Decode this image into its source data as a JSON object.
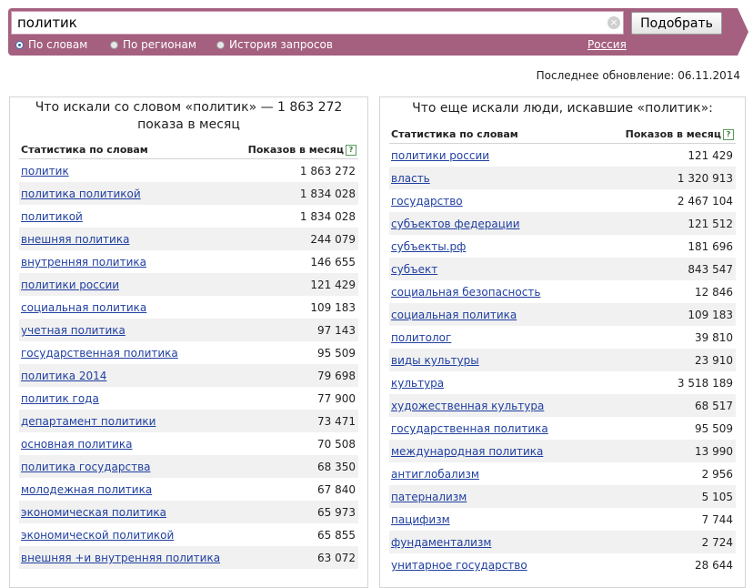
{
  "search": {
    "value": "политик",
    "submit_label": "Подобрать"
  },
  "tabs": [
    {
      "label": "По словам",
      "checked": true
    },
    {
      "label": "По регионам",
      "checked": false
    },
    {
      "label": "История запросов",
      "checked": false
    }
  ],
  "region": "Россия",
  "last_update": "Последнее обновление: 06.11.2014",
  "left": {
    "title_line1": "Что искали со словом «политик» — 1 863 272",
    "title_line2": "показа в месяц",
    "col_keyword": "Статистика по словам",
    "col_shows": "Показов в месяц",
    "rows": [
      {
        "q": "политик",
        "n": "1 863 272"
      },
      {
        "q": "политика политикой",
        "n": "1 834 028"
      },
      {
        "q": "политикой",
        "n": "1 834 028"
      },
      {
        "q": "внешняя политика",
        "n": "244 079"
      },
      {
        "q": "внутренняя политика",
        "n": "146 655"
      },
      {
        "q": "политики россии",
        "n": "121 429"
      },
      {
        "q": "социальная политика",
        "n": "109 183"
      },
      {
        "q": "учетная политика",
        "n": "97 143"
      },
      {
        "q": "государственная политика",
        "n": "95 509"
      },
      {
        "q": "политика 2014",
        "n": "79 698"
      },
      {
        "q": "политик года",
        "n": "77 900"
      },
      {
        "q": "департамент политики",
        "n": "73 471"
      },
      {
        "q": "основная политика",
        "n": "70 508"
      },
      {
        "q": "политика государства",
        "n": "68 350"
      },
      {
        "q": "молодежная политика",
        "n": "67 840"
      },
      {
        "q": "экономическая политика",
        "n": "65 973"
      },
      {
        "q": "экономической политикой",
        "n": "65 855"
      },
      {
        "q": "внешняя +и внутренняя политика",
        "n": "63 072"
      }
    ]
  },
  "right": {
    "title": "Что еще искали люди, искавшие «политик»:",
    "col_keyword": "Статистика по словам",
    "col_shows": "Показов в месяц",
    "rows": [
      {
        "q": "политики россии",
        "n": "121 429"
      },
      {
        "q": "власть",
        "n": "1 320 913"
      },
      {
        "q": "государство",
        "n": "2 467 104"
      },
      {
        "q": "субъектов федерации",
        "n": "121 512"
      },
      {
        "q": "субъекты.рф",
        "n": "181 696"
      },
      {
        "q": "субъект",
        "n": "843 547"
      },
      {
        "q": "социальная безопасность",
        "n": "12 846"
      },
      {
        "q": "социальная политика",
        "n": "109 183"
      },
      {
        "q": "политолог",
        "n": "39 810"
      },
      {
        "q": "виды культуры",
        "n": "23 910"
      },
      {
        "q": "культура",
        "n": "3 518 189"
      },
      {
        "q": "художественная культура",
        "n": "68 517"
      },
      {
        "q": "государственная политика",
        "n": "95 509"
      },
      {
        "q": "международная политика",
        "n": "13 990"
      },
      {
        "q": "антиглобализм",
        "n": "2 956"
      },
      {
        "q": "патернализм",
        "n": "5 105"
      },
      {
        "q": "пацифизм",
        "n": "7 744"
      },
      {
        "q": "фундаментализм",
        "n": "2 724"
      },
      {
        "q": "унитарное государство",
        "n": "28 644"
      }
    ]
  }
}
